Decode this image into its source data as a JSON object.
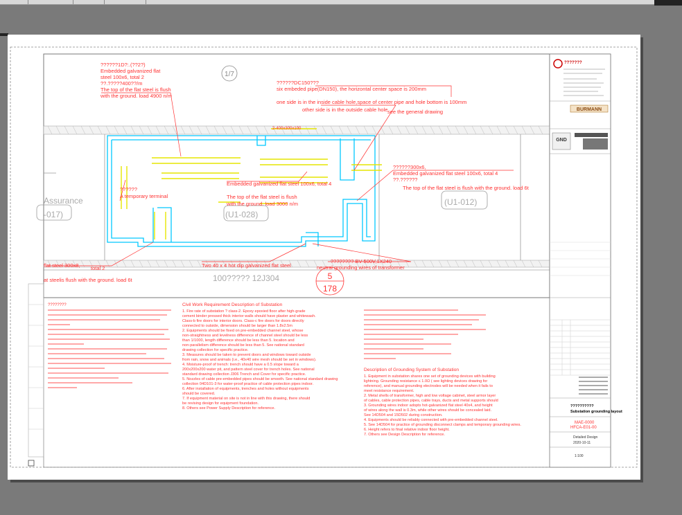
{
  "drawing": {
    "callout_top_left": [
      "??????1D?:.(??2?)",
      "Embedded galvanized flat",
      "steel 100x6, total 2",
      "??.?????400??/m",
      "The top of the flat steel is flush",
      "with the ground. load 4900 n/m"
    ],
    "grid_bubble": "1/7",
    "callout_top_center": [
      "??????DC150???",
      "six embeded pipe(DN150), the horizontal center space is 200mm",
      "one side is in the inside cable hole,space of center pipe and hole bottom is 100mm",
      "other side is in the outside cable hole",
      "see the general drawing"
    ],
    "dim_text": "2-400x300x100",
    "callout_temp_terminal": [
      "??????",
      "A temporary terminal"
    ],
    "room_label_left": [
      "Assurance",
      "-017)"
    ],
    "room_label_center": "(U1-028)",
    "room_label_right": "(U1-012)",
    "callout_mid_center": [
      "Embedded galvanized flat steel 100x6, total 4",
      "The top of the flat steel is flush",
      "with the ground. load 3000 n/m"
    ],
    "callout_mid_right": [
      "??????300x6,",
      "Embedded galvanized flat steel 100x6, total 4",
      "??.??????",
      "The top of the flat steel is flush with the ground. load 6t"
    ],
    "callout_bottom_left": [
      "flat steel 300x8,",
      "total 2",
      "at steelis flush with the ground. load 6t"
    ],
    "callout_bottom_center": [
      "Two 40 x 4 hot dip galvanized flat steel"
    ],
    "callout_bottom_right": [
      "???????? BV-500V,1X240",
      "neutral grounding wires of transformer"
    ],
    "detail_ref": "100????? 12J304",
    "detail_bubble_top": "5",
    "detail_bubble_bottom": "178",
    "notes_col1_title": "????????",
    "notes_col2_title": "Civil Work Requirement Description of Substation",
    "notes_col2": [
      "1. Fire rate of substation ? class-2. Epoxy epoxied floor after high-grade",
      "cement binder pressed thick interior walls should have plaster and whitewash.",
      "Class-b fire doors for interior doors. Class-c fire doors for doors directly",
      "connected to outside, dimension should be larger than 1.8x2.5m",
      "2. Equipments should be fixed on pre-embedded channel steel, whose",
      "non-straightness and levelness difference of channel steel should be less",
      "than 1/1000, length difference should be less than 5. location and",
      "non-parallelism difference should be less than 5. See national standard",
      "drawing collection for specific practice.",
      "3. Measures should be taken to prevent doors and windows toward outside",
      "from rain, snow and animals (i.e., 40x40 wire mesh should be set in windows).",
      "4. Moisture-proof of trench: trench should have a 0.5 slope toward a",
      "200x200x200 water pit, and pattern steel cover for trench holes. See national",
      "standard drawing collection J306 Trench and Cover for specific practice.",
      "5. Nozzles of cable pre-embedded pipes should be smooth. See national standard drawing",
      "collection 04D101-3 for water-proof practice of cable protection pipes indoor.",
      "6. After installation of equipments, trenches and holes without equipments",
      "should be covered.",
      "7. If equipment material on site is not in line with this drawing, there should",
      "be revising design for equipment foundation.",
      "8. Others see Power Supply Description for reference."
    ],
    "notes_col3_title": "Description of Grounding System of Substation",
    "notes_col3": [
      "1. Equipment in substation shares one set of grounding devices with building",
      "lightning. Grounding resistance ≤ 1.0Ω ( see lighting devices drawing for",
      "reference), and manual grounding electrodes will be needed when it fails to",
      "meet resistance requirement.",
      "2. Metal shells of transformer, high and low voltage cabinet, steel armor layer",
      "of cables, cable protection pipes, cable trays, ducts and metal supports should",
      "3. Grounding wires indoor adopts hot-galvanized flat steel 40x4, and height",
      "of wires along the wall is 0.3m, while other wires should be concealed laid.",
      "See 14D504 and 15D502 during construction.",
      "4. Equipments should be reliably connected with pre-embedded channel steel.",
      "5. See 14D504 for practice of grounding disconnect clamps and temporary grounding wires.",
      "6. Height refers to final relative indoor floor height.",
      "7. Others see Design Description for reference."
    ],
    "title_block": {
      "company_cn": "???????",
      "logo_text": "BURMANN",
      "gnd_label": "GND",
      "sheet_title_cn": "??????????",
      "sheet_title_en": "Substation grounding layout",
      "drawing_no_1": "MAE-0000",
      "drawing_no_2": "HFCA-E01-00",
      "design_stage": "Detailed Design",
      "date": "2020-10-11",
      "scale": "1:100"
    }
  }
}
